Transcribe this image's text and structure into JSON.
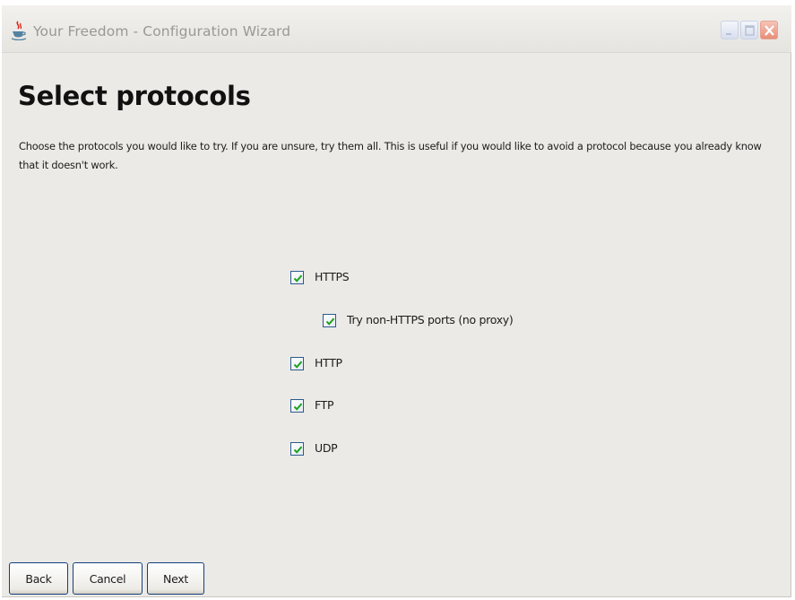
{
  "window": {
    "title": "Your Freedom - Configuration Wizard",
    "icon": "java-cup-icon"
  },
  "page": {
    "heading": "Select protocols",
    "description": "Choose the protocols you would like to try. If you are unsure, try them all. This is useful if you would like to avoid a protocol because you already know that it doesn't work."
  },
  "options": [
    {
      "label": "HTTPS",
      "checked": true
    },
    {
      "label": "Try non-HTTPS ports (no proxy)",
      "checked": true
    },
    {
      "label": "HTTP",
      "checked": true
    },
    {
      "label": "FTP",
      "checked": true
    },
    {
      "label": "UDP",
      "checked": true
    }
  ],
  "buttons": {
    "back": "Back",
    "cancel": "Cancel",
    "next": "Next"
  },
  "colors": {
    "check": "#21a121",
    "checkbox_border": "#2c5a8f",
    "close_button": "#e88e78",
    "window_background": "#ebeae6"
  }
}
